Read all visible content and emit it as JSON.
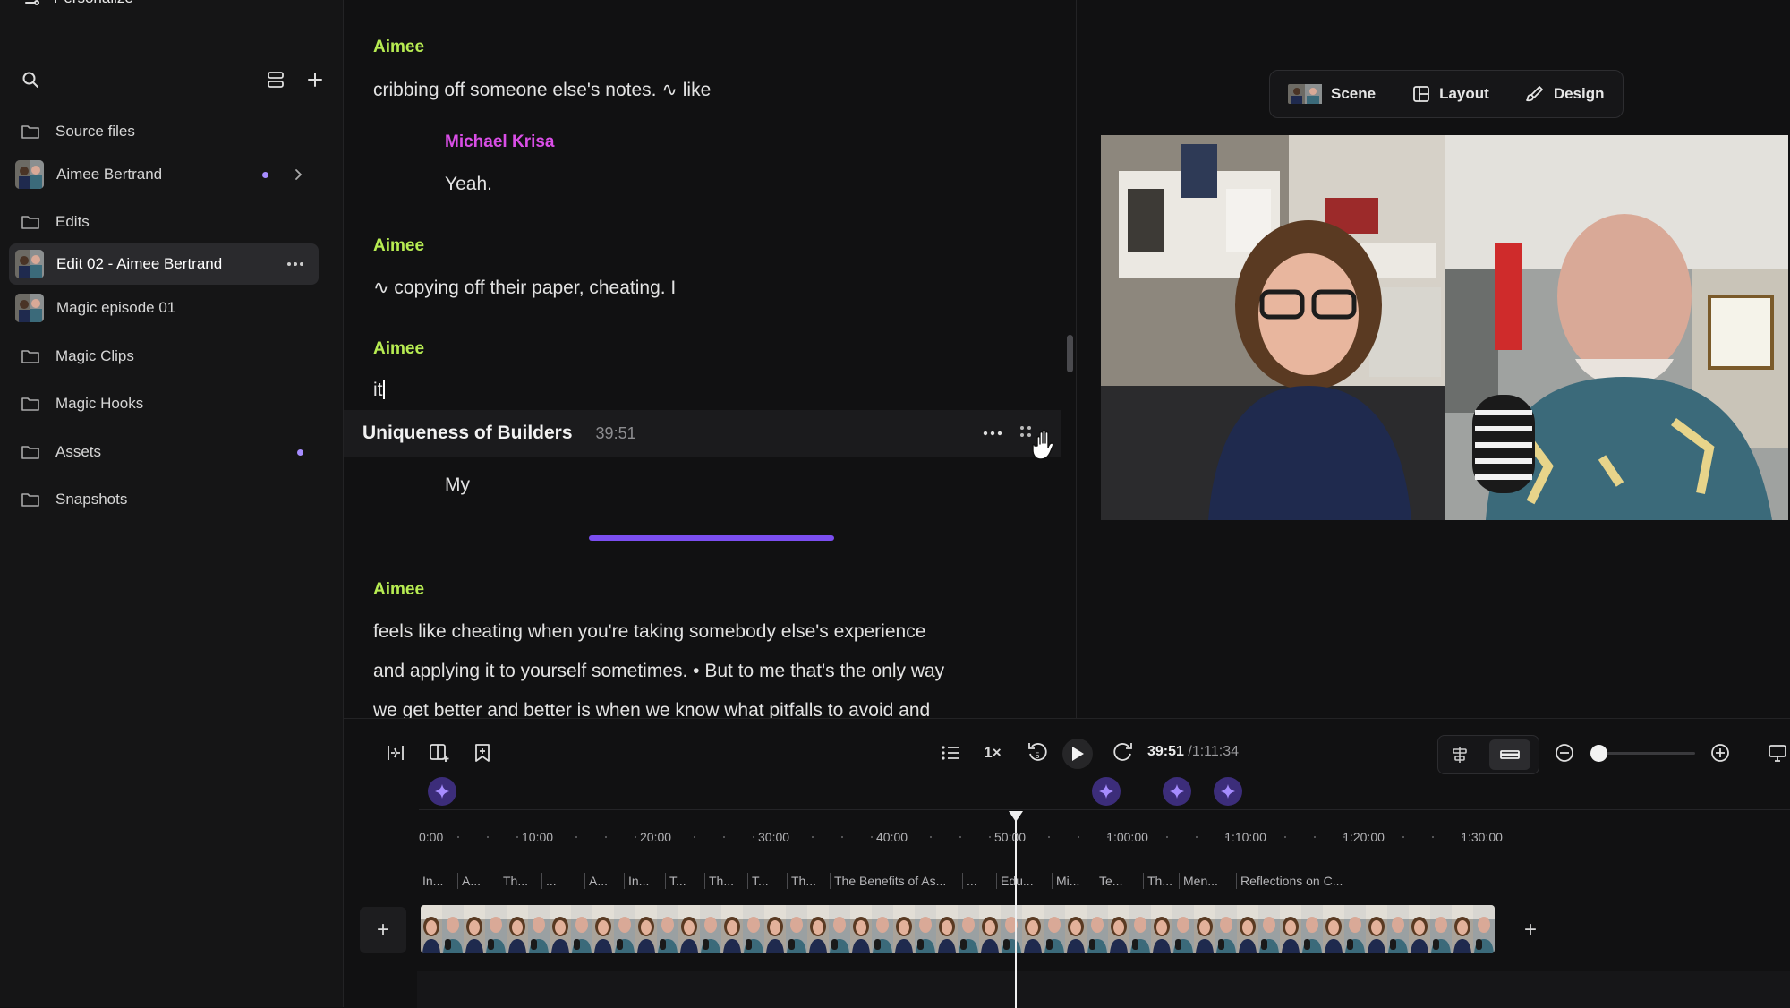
{
  "sidebar": {
    "personalize": "Personalize",
    "items": [
      {
        "label": "Source files",
        "type": "folder"
      },
      {
        "label": "Aimee Bertrand",
        "type": "project"
      },
      {
        "label": "Edits",
        "type": "folder"
      },
      {
        "label": "Edit 02 - Aimee Bertrand",
        "type": "project",
        "active": true
      },
      {
        "label": "Magic episode 01",
        "type": "project"
      },
      {
        "label": "Magic Clips",
        "type": "folder"
      },
      {
        "label": "Magic Hooks",
        "type": "folder"
      },
      {
        "label": "Assets",
        "type": "folder"
      },
      {
        "label": "Snapshots",
        "type": "folder"
      }
    ],
    "accent": "#a68cff"
  },
  "transcript": {
    "blocks": [
      {
        "speaker": "Aimee",
        "text": "cribbing off someone else's notes. ∿ like"
      },
      {
        "speaker": "Michael Krisa",
        "text": "Yeah."
      },
      {
        "speaker": "Aimee",
        "text": "∿ copying off their paper, cheating. I"
      },
      {
        "speaker": "Aimee",
        "text": "it"
      },
      {
        "speaker": "Michael Krisa",
        "text": "My"
      },
      {
        "speaker": "Aimee",
        "lines": [
          "feels like cheating when you're taking somebody else's experience",
          "and applying it to yourself sometimes. • But to me that's the only way",
          "we get better and better is when we know what pitfalls to avoid and"
        ]
      }
    ],
    "chapter": {
      "title": "Uniqueness of Builders",
      "time": "39:51"
    },
    "speaker_colors": {
      "Aimee": "#b7ec52",
      "Michael Krisa": "#d94ee6"
    }
  },
  "preview": {
    "tabs": [
      {
        "label": "Scene",
        "icon": "scene-thumbnail-icon"
      },
      {
        "label": "Layout",
        "icon": "layout-icon"
      },
      {
        "label": "Design",
        "icon": "brush-icon"
      }
    ]
  },
  "playback": {
    "speed": "1×",
    "skip_back": "5",
    "current_time": "39:51",
    "total_time": "/1:11:34",
    "zoom_level": 0.05
  },
  "timeline": {
    "ruler_labels": [
      "0:00",
      "10:00",
      "20:00",
      "30:00",
      "40:00",
      "50:00",
      "1:00:00",
      "1:10:00",
      "1:20:00",
      "1:30:00"
    ],
    "chapters": [
      "In...",
      "A...",
      "Th...",
      "...",
      "A...",
      "In...",
      "T...",
      "Th...",
      "T...",
      "Th...",
      "The Benefits of As...",
      "...",
      "Edu...",
      "Mi...",
      "Te...",
      "Th...",
      "Men...",
      "Reflections on C..."
    ],
    "add_track": "+"
  }
}
